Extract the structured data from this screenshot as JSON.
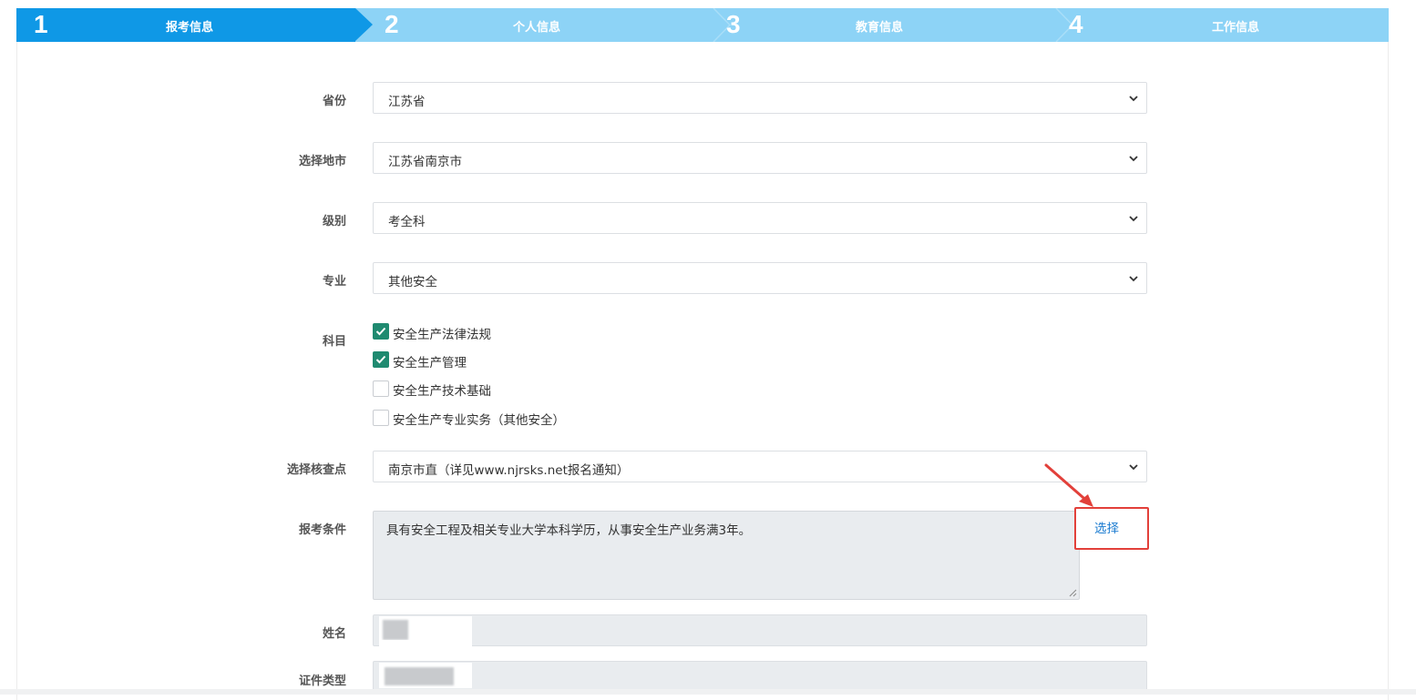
{
  "steps": [
    {
      "num": "1",
      "label": "报考信息",
      "active": true
    },
    {
      "num": "2",
      "label": "个人信息",
      "active": false
    },
    {
      "num": "3",
      "label": "教育信息",
      "active": false
    },
    {
      "num": "4",
      "label": "工作信息",
      "active": false
    }
  ],
  "form": {
    "province": {
      "label": "省份",
      "value": "江苏省"
    },
    "city": {
      "label": "选择地市",
      "value": "江苏省南京市"
    },
    "level": {
      "label": "级别",
      "value": "考全科"
    },
    "major": {
      "label": "专业",
      "value": "其他安全"
    },
    "subjects": {
      "label": "科目",
      "items": [
        {
          "label": "安全生产法律法规",
          "checked": true
        },
        {
          "label": "安全生产管理",
          "checked": true
        },
        {
          "label": "安全生产技术基础",
          "checked": false
        },
        {
          "label": "安全生产专业实务（其他安全）",
          "checked": false
        }
      ]
    },
    "checkpoint": {
      "label": "选择核查点",
      "value": "南京市直（详见www.njrsks.net报名通知）"
    },
    "condition": {
      "label": "报考条件",
      "value": "具有安全工程及相关专业大学本科学历，从事安全生产业务满3年。",
      "button": "选择"
    },
    "name": {
      "label": "姓名"
    },
    "id_type": {
      "label": "证件类型"
    }
  },
  "colors": {
    "active_step": "#0f98e6",
    "inactive_step": "#8dd3f6",
    "checked": "#1f8a70",
    "highlight": "#e2403a",
    "link": "#1a7bd0"
  }
}
